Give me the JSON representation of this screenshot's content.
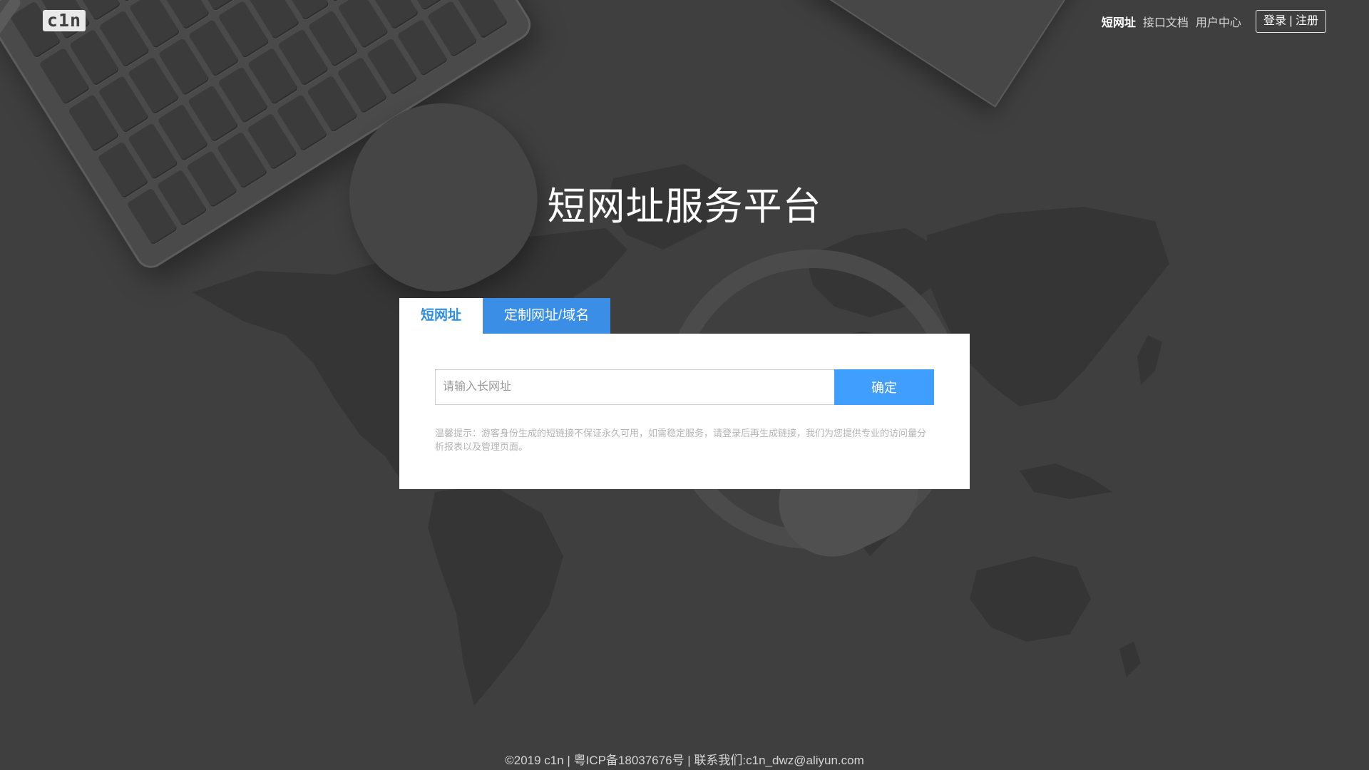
{
  "header": {
    "logo_text": "c1n",
    "nav": [
      {
        "label": "短网址",
        "active": true
      },
      {
        "label": "接口文档",
        "active": false
      },
      {
        "label": "用户中心",
        "active": false
      }
    ],
    "auth_label": "登录 | 注册"
  },
  "hero": {
    "title": "短网址服务平台"
  },
  "tabs": [
    {
      "label": "短网址",
      "active": true
    },
    {
      "label": "定制网址/域名",
      "active": false
    }
  ],
  "form": {
    "placeholder": "请输入长网址",
    "value": "",
    "submit_label": "确定",
    "notice": "温馨提示：游客身份生成的短链接不保证永久可用，如需稳定服务，请登录后再生成链接，我们为您提供专业的访问量分析报表以及管理页面。"
  },
  "footer": {
    "text": "©2019 c1n | 粤ICP备18037676号 | 联系我们:c1n_dwz@aliyun.com"
  },
  "colors": {
    "background": "#3f3f3f",
    "accent": "#409eff",
    "tab_active_text": "#2f8ee0",
    "tab_inactive_bg": "#3a8ee6"
  }
}
